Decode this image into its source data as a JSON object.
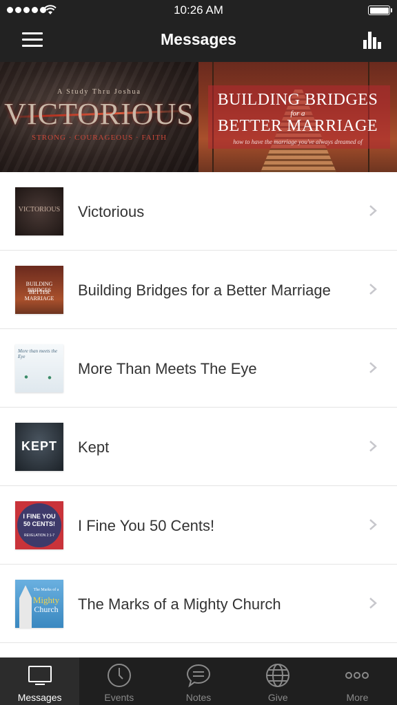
{
  "status_bar": {
    "time": "10:26 AM"
  },
  "nav": {
    "title": "Messages"
  },
  "banner": [
    {
      "eyebrow": "A Study Thru Joshua",
      "title": "VICTORIOUS",
      "tagline": "STRONG · COURAGEOUS · FAITH"
    },
    {
      "line1": "BUILDING BRIDGES",
      "connector": "for a",
      "line2": "BETTER MARRIAGE",
      "tagline": "how to have the marriage you've always dreamed of"
    }
  ],
  "series": [
    {
      "title": "Victorious",
      "thumb_text": "VICTORIOUS"
    },
    {
      "title": "Building Bridges for a Better Marriage",
      "thumb_line1": "BUILDING BRIDGES",
      "thumb_line2": "BETTER MARRIAGE"
    },
    {
      "title": "More Than Meets The Eye",
      "thumb_text": "More than meets the Eye"
    },
    {
      "title": "Kept",
      "thumb_text": "KEPT"
    },
    {
      "title": "I Fine You 50 Cents!",
      "thumb_line1": "I FINE YOU",
      "thumb_line2": "50 CENTS!",
      "thumb_ref": "REVELATION 2:1-7"
    },
    {
      "title": "The Marks of a Mighty Church",
      "thumb_line1": "The Marks of a",
      "thumb_line2": "Mighty",
      "thumb_line3": "Church"
    }
  ],
  "tabs": [
    {
      "label": "Messages",
      "icon": "tv-icon",
      "active": true
    },
    {
      "label": "Events",
      "icon": "clock-icon"
    },
    {
      "label": "Notes",
      "icon": "chat-bubble-icon"
    },
    {
      "label": "Give",
      "icon": "globe-icon"
    },
    {
      "label": "More",
      "icon": "more-dots-icon"
    }
  ]
}
